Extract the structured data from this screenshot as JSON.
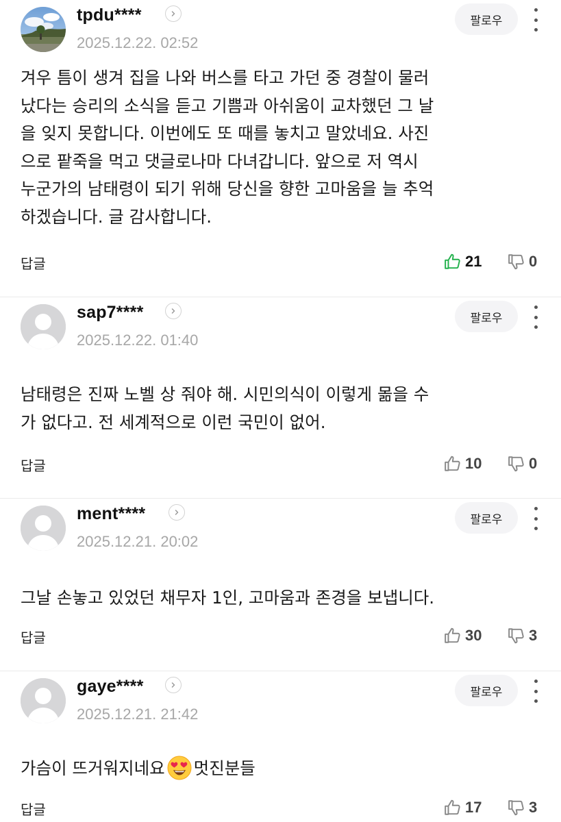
{
  "follow_label": "팔로우",
  "reply_label": "답글",
  "colors": {
    "like_active": "#22b14c",
    "icon_gray": "#888888",
    "date_gray": "#a7a7a7"
  },
  "comments": [
    {
      "username": "tpdu****",
      "date": "2025.12.22. 02:52",
      "avatar": "photo",
      "text": "겨우 틈이 생겨 집을 나와 버스를 타고 가던 중 경찰이 물러\n났다는 승리의 소식을 듣고 기쁨과 아쉬움이 교차했던 그 날\n을 잊지 못합니다. 이번에도 또 때를 놓치고 말았네요. 사진\n으로 팥죽을 먹고 댓글로나마 다녀갑니다. 앞으로 저 역시\n누군가의 남태령이 되기 위해 당신을 향한 고마움을 늘 추억\n하겠습니다. 글 감사합니다.",
      "likes": "21",
      "dislikes": "0",
      "liked": true
    },
    {
      "username": "sap7****",
      "date": "2025.12.22. 01:40",
      "avatar": "default",
      "text": "남태령은 진짜 노벨 상 줘야 해. 시민의식이 이렇게 �googl 수\n가 없다고. 전 세계적으로 이런 국민이 없어.",
      "likes": "10",
      "dislikes": "0",
      "liked": false
    },
    {
      "username": "ment****",
      "date": "2025.12.21. 20:02",
      "avatar": "default",
      "text": "그날 손놓고 있었던 채무자 1인, 고마움과 존경을 보냅니다.",
      "likes": "30",
      "dislikes": "3",
      "liked": false
    },
    {
      "username": "gaye****",
      "date": "2025.12.21. 21:42",
      "avatar": "default",
      "text_before_emoji": "가슴이 뜨거워지네요",
      "emoji": "smiling-face-with-heart-eyes",
      "text_after_emoji": "멋진분들",
      "likes": "17",
      "dislikes": "3",
      "liked": false
    }
  ]
}
